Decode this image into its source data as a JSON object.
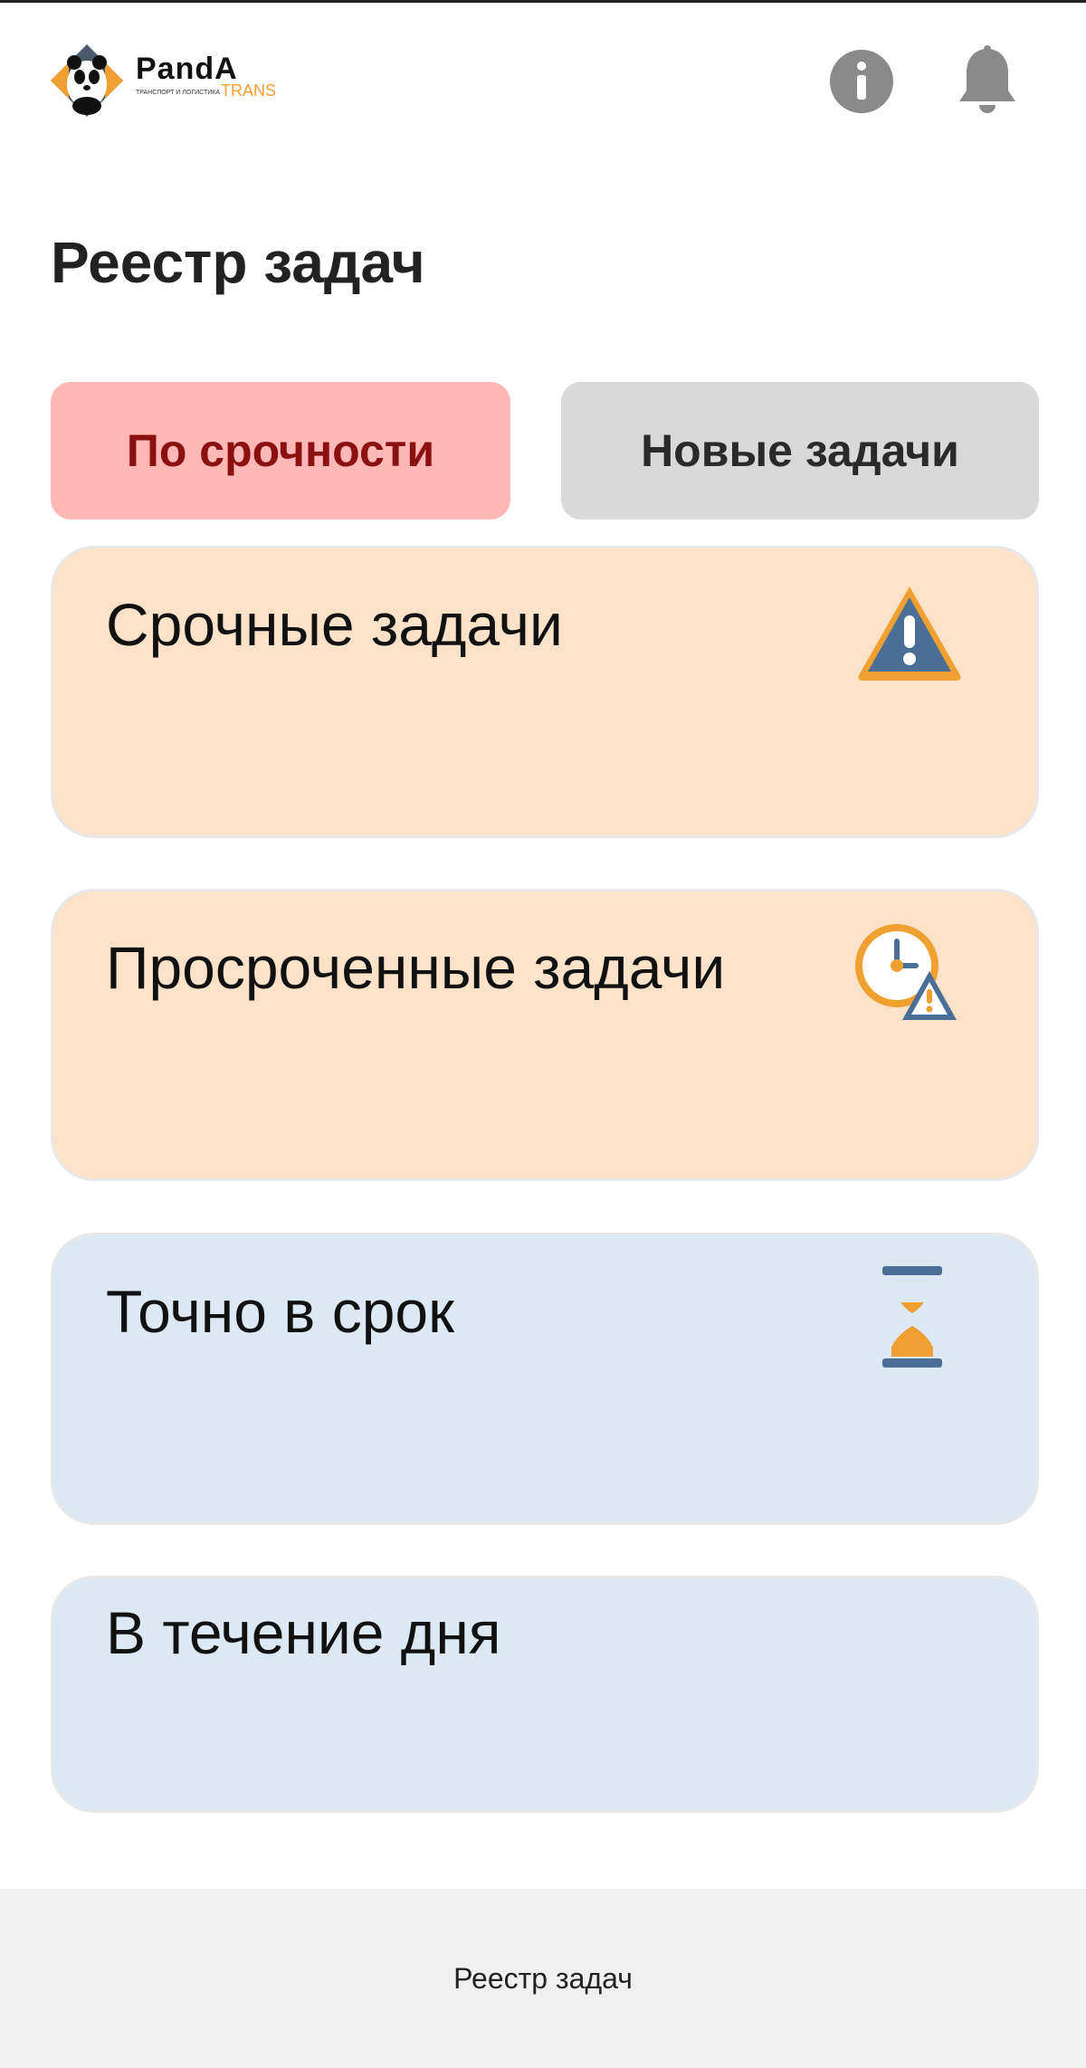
{
  "header": {
    "logo_word": "PandA",
    "logo_sub": "ТРАНСПОРТ И ЛОГИСТИКА",
    "logo_trans": "TRANS",
    "info_icon": "info-icon",
    "bell_icon": "bell-icon"
  },
  "page": {
    "title": "Реестр задач"
  },
  "tabs": [
    {
      "label": "По срочности",
      "active": true,
      "color": "#ffb8b6",
      "text_color": "#8b1010"
    },
    {
      "label": "Новые задачи",
      "active": false,
      "color": "#d9d9d9",
      "text_color": "#2a2a2a"
    }
  ],
  "cards": [
    {
      "title": "Срочные задачи",
      "icon": "warning-icon",
      "color": "#fbe2c8"
    },
    {
      "title": "Просроченные задачи",
      "icon": "clock-warning-icon",
      "color": "#fbe2c8"
    },
    {
      "title": "Точно в срок",
      "icon": "hourglass-icon",
      "color": "#dde8f5"
    },
    {
      "title": "В течение дня",
      "icon": "",
      "color": "#dde8f5"
    }
  ],
  "footer": {
    "nav_label": "Реестр задач"
  },
  "colors": {
    "accent_orange": "#f0a030",
    "icon_blue": "#4a6e96",
    "icon_gray": "#8a8a8a"
  }
}
